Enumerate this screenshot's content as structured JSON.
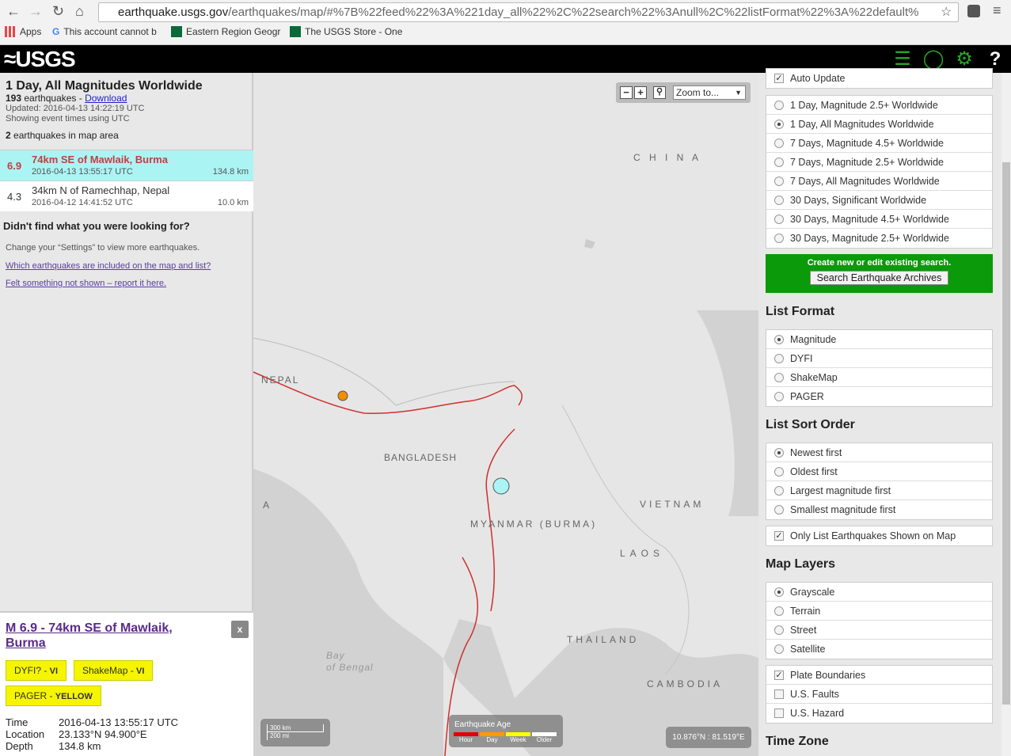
{
  "browser": {
    "url_host": "earthquake.usgs.gov",
    "url_rest": "/earthquakes/map/#%7B%22feed%22%3A%221day_all%22%2C%22search%22%3Anull%2C%22listFormat%22%3A%22default%",
    "bookmarks": [
      "Apps",
      "This account cannot b",
      "Eastern Region Geogr",
      "The USGS Store - One"
    ]
  },
  "header": {
    "logo": "USGS"
  },
  "summary": {
    "title": "1 Day, All Magnitudes Worldwide",
    "count": "193",
    "count_suffix": " earthquakes - ",
    "download": "Download",
    "updated": "Updated: 2016-04-13 14:22:19 UTC",
    "times": "Showing event times using UTC",
    "in_area_count": "2",
    "in_area_suffix": " earthquakes in map area"
  },
  "earthquakes": [
    {
      "mag": "6.9",
      "place": "74km SE of Mawlaik, Burma",
      "time": "2016-04-13 13:55:17 UTC",
      "depth": "134.8 km"
    },
    {
      "mag": "4.3",
      "place": "34km N of Ramechhap, Nepal",
      "time": "2016-04-12 14:41:52 UTC",
      "depth": "10.0 km"
    }
  ],
  "help": {
    "heading": "Didn't find what you were looking for?",
    "settings": "Change your “Settings” to view more earthquakes.",
    "link1": "Which earthquakes are included on the map and list?",
    "link2": "Felt something not shown – report it here."
  },
  "popup": {
    "title": "M 6.9 - 74km SE of Mawlaik, Burma",
    "close": "x",
    "dyfi": "DYFI? - ",
    "dyfi_val": "VI",
    "shakemap": "ShakeMap - ",
    "shakemap_val": "VI",
    "pager": "PAGER - ",
    "pager_val": "YELLOW",
    "time_label": "Time",
    "time": "2016-04-13 13:55:17 UTC",
    "location_label": "Location",
    "location": "23.133°N 94.900°E",
    "depth_label": "Depth",
    "depth": "134.8 km"
  },
  "map": {
    "zoom_to": "Zoom to...",
    "labels": [
      "C H I N A",
      "NEPAL",
      "BANGLADESH",
      "MYANMAR (BURMA)",
      "VIETNAM",
      "LAOS",
      "THAILAND",
      "CAMBODIA",
      "Bay",
      "of Bengal",
      "A"
    ],
    "scale_km": "300 km",
    "scale_mi": "200 mi",
    "legend_title": "Earthquake Age",
    "legend": [
      {
        "label": "Hour",
        "color": "#e00000"
      },
      {
        "label": "Day",
        "color": "#ff9900"
      },
      {
        "label": "Week",
        "color": "#ffff00"
      },
      {
        "label": "Older",
        "color": "#ffffff"
      }
    ],
    "coords": "10.876°N : 81.519°E",
    "event_colors": {
      "selected": "#aaf4f4",
      "day": "#f09000"
    }
  },
  "settings": {
    "auto_update": "Auto Update",
    "feeds": [
      "1 Day, Magnitude 2.5+ Worldwide",
      "1 Day, All Magnitudes Worldwide",
      "7 Days, Magnitude 4.5+ Worldwide",
      "7 Days, Magnitude 2.5+ Worldwide",
      "7 Days, All Magnitudes Worldwide",
      "30 Days, Significant Worldwide",
      "30 Days, Magnitude 4.5+ Worldwide",
      "30 Days, Magnitude 2.5+ Worldwide"
    ],
    "search_note": "Create new or edit existing search.",
    "search_button": "Search Earthquake Archives",
    "list_format_title": "List Format",
    "list_formats": [
      "Magnitude",
      "DYFI",
      "ShakeMap",
      "PAGER"
    ],
    "sort_title": "List Sort Order",
    "sorts": [
      "Newest first",
      "Oldest first",
      "Largest magnitude first",
      "Smallest magnitude first"
    ],
    "only_on_map": "Only List Earthquakes Shown on Map",
    "layers_title": "Map Layers",
    "base_layers": [
      "Grayscale",
      "Terrain",
      "Street",
      "Satellite"
    ],
    "overlays": [
      "Plate Boundaries",
      "U.S. Faults",
      "U.S. Hazard"
    ],
    "timezone_title": "Time Zone"
  }
}
